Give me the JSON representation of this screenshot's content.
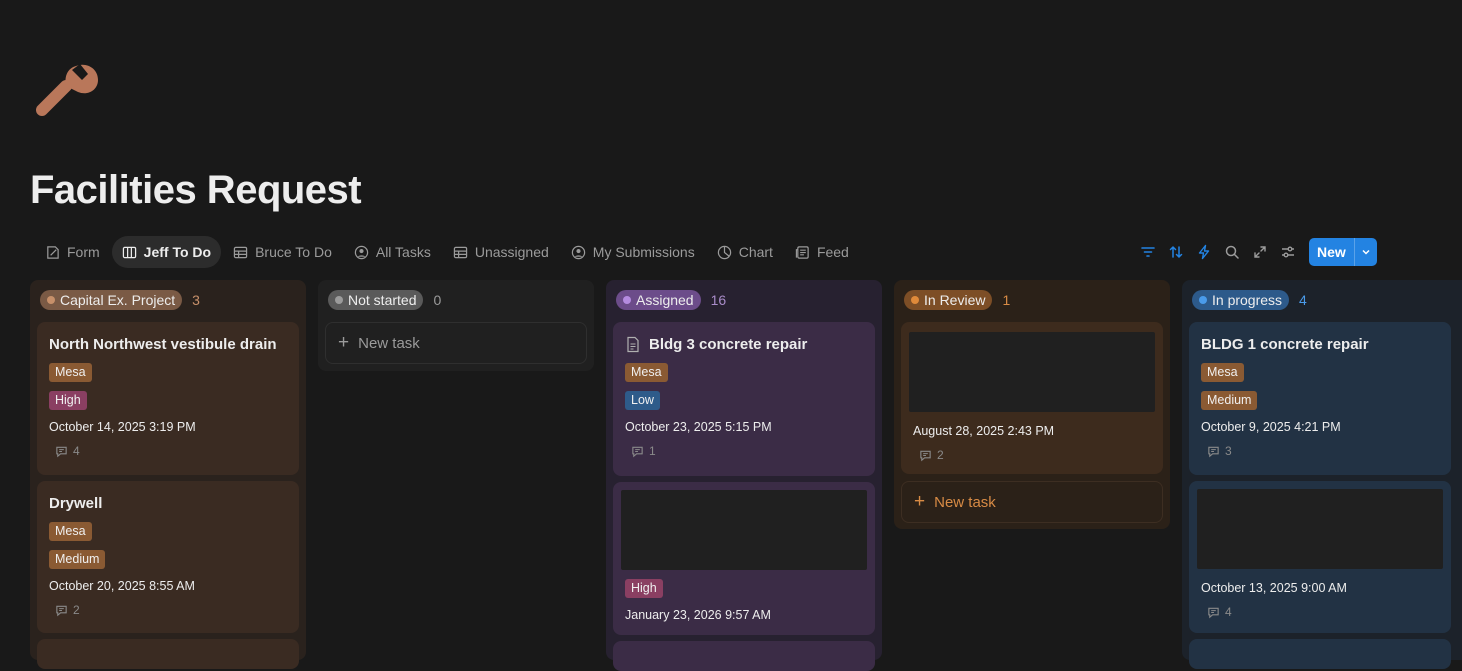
{
  "page": {
    "title": "Facilities Request",
    "icon": "wrench-icon"
  },
  "tabs": [
    {
      "label": "Form",
      "icon": "form-icon"
    },
    {
      "label": "Jeff To Do",
      "icon": "board-icon",
      "active": true
    },
    {
      "label": "Bruce To Do",
      "icon": "table-icon"
    },
    {
      "label": "All Tasks",
      "icon": "person-circle-icon"
    },
    {
      "label": "Unassigned",
      "icon": "table-icon"
    },
    {
      "label": "My Submissions",
      "icon": "person-circle-icon"
    },
    {
      "label": "Chart",
      "icon": "pie-chart-icon"
    },
    {
      "label": "Feed",
      "icon": "feed-icon"
    }
  ],
  "toolbar": {
    "icons": [
      "filter-icon",
      "sort-icon",
      "automation-icon",
      "search-icon",
      "expand-icon",
      "settings-icon"
    ],
    "new_label": "New",
    "accent": "#2383e2"
  },
  "columns": [
    {
      "status": "Capital Ex. Project",
      "count": "3",
      "colors": {
        "bg": "#2a221d",
        "pill": "#7a5a45",
        "dot": "#c7906a",
        "count": "#c7906a",
        "card": "#3a2b22"
      },
      "cards": [
        {
          "title": "North Northwest vestibule drain",
          "tags": [
            "Mesa",
            "High"
          ],
          "date": "October 14, 2025 3:19 PM",
          "comments": "4"
        },
        {
          "title": "Drywell",
          "tags": [
            "Mesa",
            "Medium"
          ],
          "date": "October 20, 2025 8:55 AM",
          "comments": "2"
        }
      ]
    },
    {
      "status": "Not started",
      "count": "0",
      "colors": {
        "bg": "#202020",
        "pill": "#5a5a5a",
        "dot": "#9b9b9b",
        "count": "#9b9b9b",
        "card": "#252525"
      },
      "new_task": "New task"
    },
    {
      "status": "Assigned",
      "count": "16",
      "colors": {
        "bg": "#272130",
        "pill": "#6c4c8a",
        "dot": "#b58be0",
        "count": "#a98cc9",
        "card": "#3b2c46"
      },
      "cards": [
        {
          "title": "Bldg 3 concrete repair",
          "tags": [
            "Mesa",
            "Low"
          ],
          "date": "October 23, 2025 5:15 PM",
          "comments": "1"
        },
        {
          "tags": [
            "High"
          ],
          "date": "January 23, 2026 9:57 AM"
        }
      ]
    },
    {
      "status": "In Review",
      "count": "1",
      "colors": {
        "bg": "#2b2118",
        "pill": "#7d4e26",
        "dot": "#e08a3a",
        "count": "#d88b45",
        "card": "#3d2b1d"
      },
      "cards": [
        {
          "date": "August 28, 2025 2:43 PM",
          "comments": "2"
        }
      ],
      "new_task": "New task"
    },
    {
      "status": "In progress",
      "count": "4",
      "colors": {
        "bg": "#1c222a",
        "pill": "#2d5a8a",
        "dot": "#4a9bea",
        "count": "#4a9bea",
        "card": "#223244"
      },
      "cards": [
        {
          "title": "BLDG 1 concrete repair",
          "tags": [
            "Mesa",
            "Medium"
          ],
          "date": "October 9, 2025 4:21 PM",
          "comments": "3"
        },
        {
          "date": "October 13, 2025 9:00 AM",
          "comments": "4"
        }
      ]
    }
  ],
  "tag_colors": {
    "Mesa": "#8a5a33",
    "High": "#8a3f62",
    "Medium": "#8a5a33",
    "Low": "#2e5b8a"
  }
}
